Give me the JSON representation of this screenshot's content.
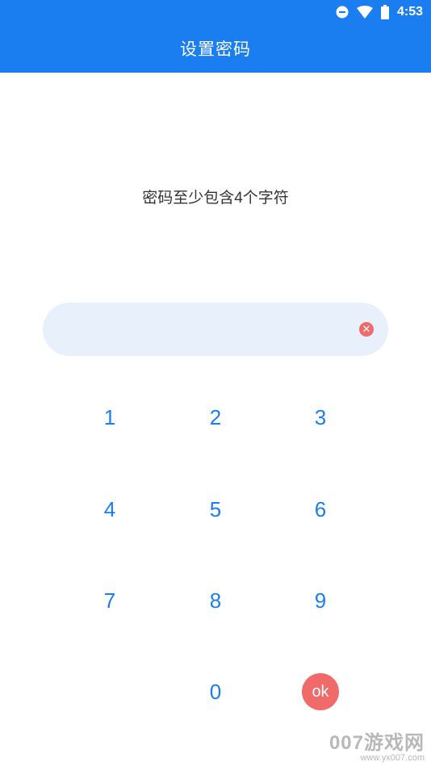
{
  "status_bar": {
    "time": "4:53",
    "icons": [
      "do-not-disturb-icon",
      "wifi-icon",
      "battery-icon"
    ]
  },
  "app_bar": {
    "title": "设置密码"
  },
  "prompt": "密码至少包含4个字符",
  "password_input": {
    "value": ""
  },
  "keypad": {
    "keys": [
      "1",
      "2",
      "3",
      "4",
      "5",
      "6",
      "7",
      "8",
      "9",
      "0"
    ],
    "ok_label": "ok"
  },
  "watermark": {
    "brand": "007游戏网",
    "url": "www.yx007.com"
  },
  "colors": {
    "primary": "#1a7ef0",
    "accent_red": "#f06a6a",
    "input_bg": "#e8f0fc",
    "text": "#333333"
  }
}
